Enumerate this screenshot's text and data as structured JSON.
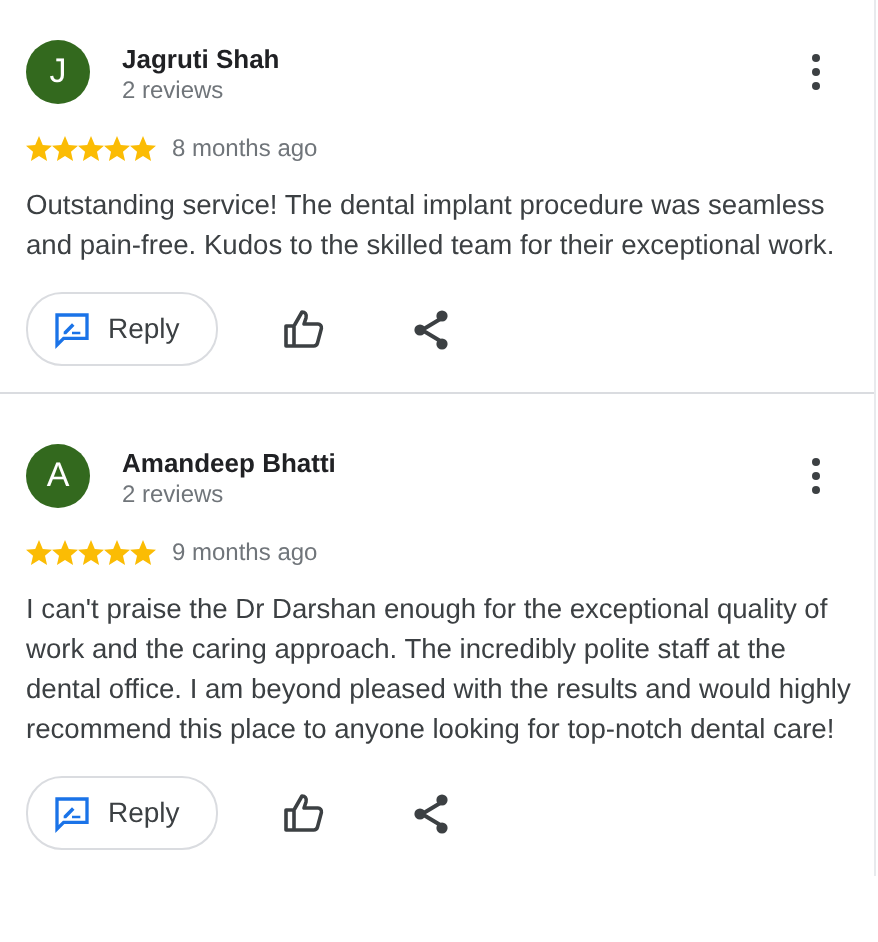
{
  "reviews": [
    {
      "initial": "J",
      "color": "#33691e",
      "name": "Jagruti Shah",
      "reviews_count": "2 reviews",
      "stars": 5,
      "time": "8 months ago",
      "text": "Outstanding service! The dental implant procedure was seamless and pain-free. Kudos to the skilled team for their exceptional work.",
      "reply_label": "Reply"
    },
    {
      "initial": "A",
      "color": "#33691e",
      "name": "Amandeep Bhatti",
      "reviews_count": "2 reviews",
      "stars": 5,
      "time": "9 months ago",
      "text": "I can't praise the Dr Darshan enough for the exceptional quality of work and the caring approach. The incredibly polite staff at the dental office. I am beyond pleased with the results and would highly recommend this place to anyone looking for top-notch dental care!",
      "reply_label": "Reply"
    }
  ]
}
